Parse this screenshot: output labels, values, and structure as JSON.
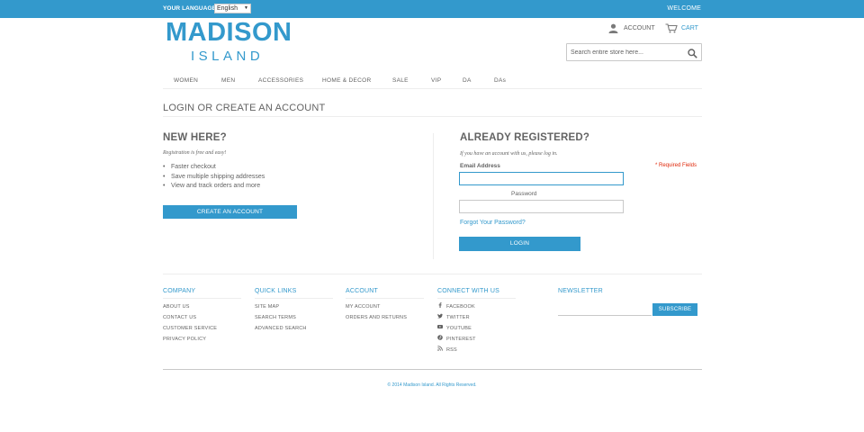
{
  "topbar": {
    "language_label": "YOUR LANGUAGE:",
    "language_selected": "English",
    "welcome": "WELCOME"
  },
  "header": {
    "logo_main": "MADISON",
    "logo_sub": "ISLAND",
    "account_label": "ACCOUNT",
    "cart_label": "CART",
    "search_placeholder": "Search entire store here..."
  },
  "nav": {
    "items": [
      {
        "label": "WOMEN"
      },
      {
        "label": "MEN"
      },
      {
        "label": "ACCESSORIES"
      },
      {
        "label": "HOME & DECOR"
      },
      {
        "label": "SALE"
      },
      {
        "label": "VIP"
      },
      {
        "label": "DA"
      },
      {
        "label": "DAs"
      }
    ]
  },
  "page": {
    "title": "LOGIN OR CREATE AN ACCOUNT"
  },
  "new_customer": {
    "title": "NEW HERE?",
    "subtitle": "Registration is free and easy!",
    "benefits": [
      "Faster checkout",
      "Save multiple shipping addresses",
      "View and track orders and more"
    ],
    "button": "CREATE AN ACCOUNT"
  },
  "login": {
    "title": "ALREADY REGISTERED?",
    "subtitle": "If you have an account with us, please log in.",
    "email_label": "Email Address",
    "password_label": "Password",
    "required_note": "* Required Fields",
    "forgot_link": "Forgot Your Password?",
    "button": "LOGIN"
  },
  "footer": {
    "columns": [
      {
        "title": "COMPANY",
        "items": [
          "ABOUT US",
          "CONTACT US",
          "CUSTOMER SERVICE",
          "PRIVACY POLICY"
        ]
      },
      {
        "title": "QUICK LINKS",
        "items": [
          "SITE MAP",
          "SEARCH TERMS",
          "ADVANCED SEARCH"
        ]
      },
      {
        "title": "ACCOUNT",
        "items": [
          "MY ACCOUNT",
          "ORDERS AND RETURNS"
        ]
      },
      {
        "title": "CONNECT WITH US",
        "items": [
          "FACEBOOK",
          "TWITTER",
          "YOUTUBE",
          "PINTEREST",
          "RSS"
        ]
      }
    ],
    "newsletter_title": "NEWSLETTER",
    "subscribe_button": "SUBSCRIBE",
    "copyright": "© 2014 Madison Island. All Rights Reserved."
  },
  "colors": {
    "brand_blue": "#3399cc",
    "text_gray": "#636363",
    "required_red": "#df280a"
  },
  "icons": {
    "account": "user-icon",
    "cart": "cart-icon",
    "search": "magnifier-icon",
    "facebook": "facebook-icon",
    "twitter": "twitter-icon",
    "youtube": "youtube-icon",
    "pinterest": "pinterest-icon",
    "rss": "rss-icon"
  }
}
